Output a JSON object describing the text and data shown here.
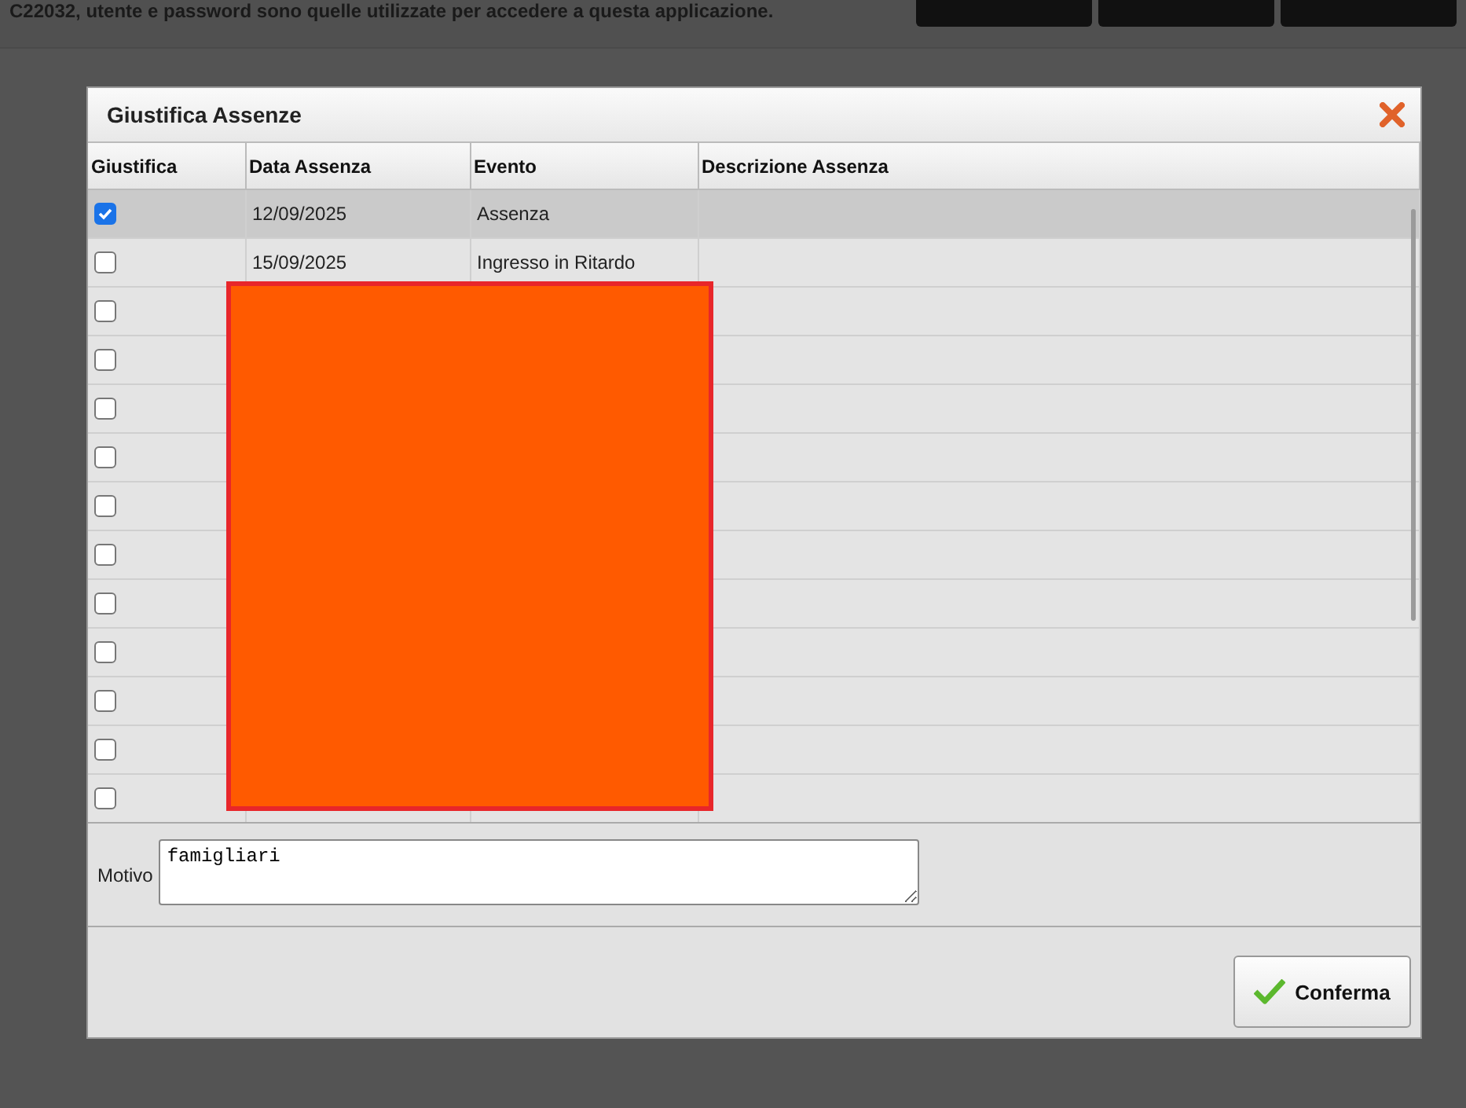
{
  "page": {
    "notice": "C22032, utente e password sono quelle utilizzate per accedere a questa applicazione."
  },
  "dialog": {
    "title": "Giustifica Assenze",
    "table": {
      "columns": [
        "Giustifica",
        "Data Assenza",
        "Evento",
        "Descrizione Assenza"
      ],
      "rows": [
        {
          "checked": true,
          "selected": true,
          "date": "12/09/2025",
          "event": "Assenza"
        },
        {
          "checked": false,
          "selected": false,
          "date": "15/09/2025",
          "event": "Ingresso in Ritardo"
        },
        {
          "checked": false,
          "selected": false
        },
        {
          "checked": false,
          "selected": false
        },
        {
          "checked": false,
          "selected": false
        },
        {
          "checked": false,
          "selected": false
        },
        {
          "checked": false,
          "selected": false
        },
        {
          "checked": false,
          "selected": false
        },
        {
          "checked": false,
          "selected": false
        },
        {
          "checked": false,
          "selected": false
        },
        {
          "checked": false,
          "selected": false
        },
        {
          "checked": false,
          "selected": false
        },
        {
          "checked": false,
          "selected": false
        }
      ],
      "redacted": true
    },
    "motivo": {
      "label": "Motivo",
      "value": "famigliari"
    },
    "confirm": "Conferma"
  }
}
